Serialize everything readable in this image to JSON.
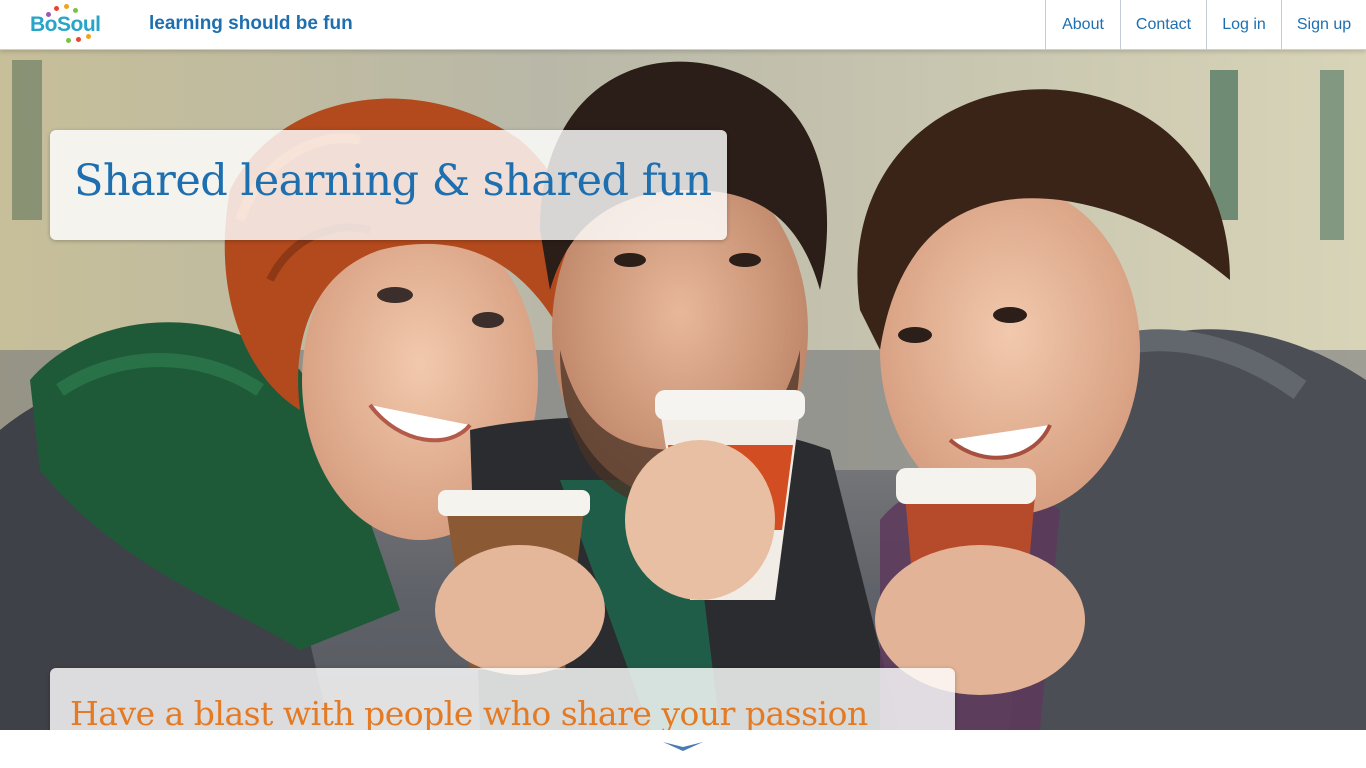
{
  "header": {
    "logo_text": "BoSoul",
    "tagline": "learning should be fun",
    "nav": [
      {
        "label": "About"
      },
      {
        "label": "Contact"
      },
      {
        "label": "Log in"
      },
      {
        "label": "Sign up"
      }
    ]
  },
  "hero": {
    "headline": "Shared learning & shared fun",
    "subheadline": "Have a blast with people who share your passion",
    "image_subject": "three friends smiling holding coffee cups"
  },
  "colors": {
    "brand_blue": "#1e6fb0",
    "logo_teal": "#27a5c9",
    "accent_orange": "#e47a23"
  },
  "icons": {
    "scroll": "chevron-down-icon"
  }
}
